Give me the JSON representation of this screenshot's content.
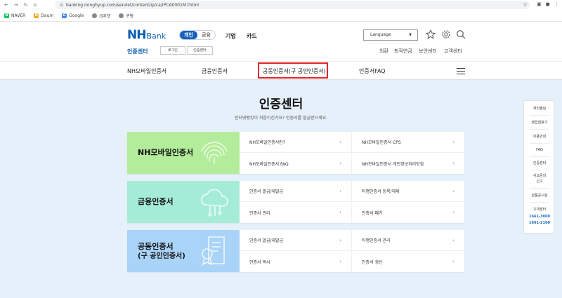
{
  "browser": {
    "url": "banking.nonghyup.com/servlet/content/ip/ca/IPCA0001M.thtml",
    "bookmarks": [
      "NAVER",
      "Daum",
      "Google",
      "G마켓",
      "쿠팡"
    ]
  },
  "header": {
    "logo_nh": "NH",
    "logo_bank": "Bank",
    "segments": [
      "개인",
      "금융"
    ],
    "gnb": [
      "기업",
      "카드"
    ],
    "language": "Language",
    "subtitle": "인증센터",
    "buttons": [
      "로그인",
      "인증센터"
    ],
    "utility": [
      "외환",
      "퇴직연금",
      "보안센터",
      "고객센터"
    ]
  },
  "tabs": [
    "NH모바일인증서",
    "금융인증서",
    "공동인증서(구 공인인증서)",
    "인증서FAQ"
  ],
  "main": {
    "title": "인증센터",
    "description": "인터넷뱅킹이 처음이신가요? 인증서를 발급받으세요.",
    "rows": [
      {
        "title_lines": [
          "NH모바일인증서"
        ],
        "links": [
          "NH모바일인증서란?",
          "NH모바일인증서 CPS",
          "NH모바일인증서 FAQ",
          "NH모바일인증서 개인정보처리방침"
        ]
      },
      {
        "title_lines": [
          "금융인증서"
        ],
        "links": [
          "인증서 발급/재발급",
          "타행인증서 등록/해제",
          "인증서 관리",
          "인증서 폐기"
        ]
      },
      {
        "title_lines": [
          "공동인증서",
          "(구 공인인증서)"
        ],
        "links": [
          "인증서 발급/재발급",
          "타행인증서 관리",
          "인증서 복사",
          "인증서 갱신"
        ]
      }
    ]
  },
  "quick_menu": {
    "items": [
      "개인뱅킹",
      "영업점찾기",
      "이용안내",
      "FAQ",
      "인증센터",
      "사고문의",
      "신고",
      "상품공시실",
      "고객센터"
    ],
    "phones": [
      "1661-3000",
      "1661-2100"
    ]
  },
  "colors": {
    "brand": "#0a5fb4",
    "row_mobile": "#b3ec9a",
    "row_finance": "#a5ecd7",
    "row_joint": "#a9d3f7",
    "highlight": "#e4242c"
  }
}
